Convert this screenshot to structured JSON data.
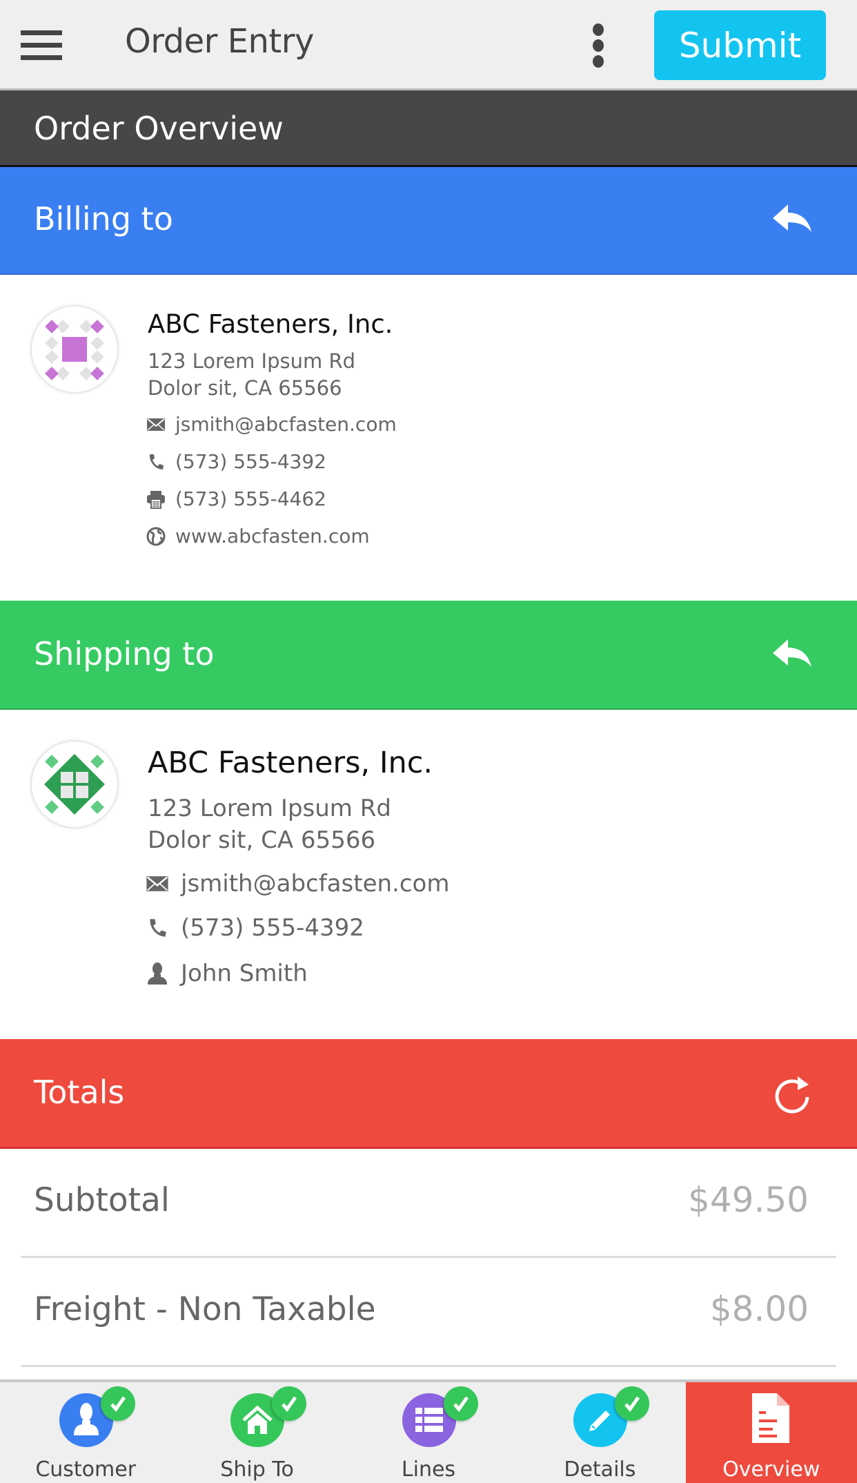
{
  "topbar": {
    "menu_icon": "hamburger-menu-icon",
    "title": "Order Entry",
    "more_icon": "more-vertical-icon",
    "submit_label": "Submit"
  },
  "overview_bar": {
    "title": "Order Overview"
  },
  "billing": {
    "header": "Billing to",
    "header_icon": "reply-arrow-icon",
    "company": "ABC Fasteners, Inc.",
    "address_line1": "123 Lorem Ipsum Rd",
    "address_line2": "Dolor sit, CA 65566",
    "email": "jsmith@abcfasten.com",
    "phone": "(573) 555-4392",
    "fax": "(573) 555-4462",
    "website": "www.abcfasten.com"
  },
  "shipping": {
    "header": "Shipping to",
    "header_icon": "reply-arrow-icon",
    "company": "ABC Fasteners, Inc.",
    "address_line1": "123 Lorem Ipsum Rd",
    "address_line2": "Dolor sit, CA 65566",
    "email": "jsmith@abcfasten.com",
    "phone": "(573) 555-4392",
    "contact": "John Smith"
  },
  "totals": {
    "header": "Totals",
    "header_icon": "refresh-icon",
    "rows": [
      {
        "label": "Subtotal",
        "value": "$49.50"
      },
      {
        "label": "Freight - Non Taxable",
        "value": "$8.00"
      }
    ]
  },
  "tabs": [
    {
      "label": "Customer",
      "icon": "user-icon",
      "color": "#3a7ff2",
      "completed": true
    },
    {
      "label": "Ship To",
      "icon": "home-icon",
      "color": "#35c75a",
      "completed": true
    },
    {
      "label": "Lines",
      "icon": "list-icon",
      "color": "#8a63e0",
      "completed": true
    },
    {
      "label": "Details",
      "icon": "pencil-icon",
      "color": "#13c4f0",
      "completed": true
    },
    {
      "label": "Overview",
      "icon": "document-icon",
      "color": "#ef4a3e",
      "active": true
    }
  ],
  "colors": {
    "submit": "#13c4f0",
    "overview_bar": "#474747",
    "billing": "#3a7ff2",
    "shipping": "#35cb62",
    "totals": "#ef4a3e",
    "billing_logo": "#c774d6",
    "shipping_logo": "#2e9e52"
  }
}
